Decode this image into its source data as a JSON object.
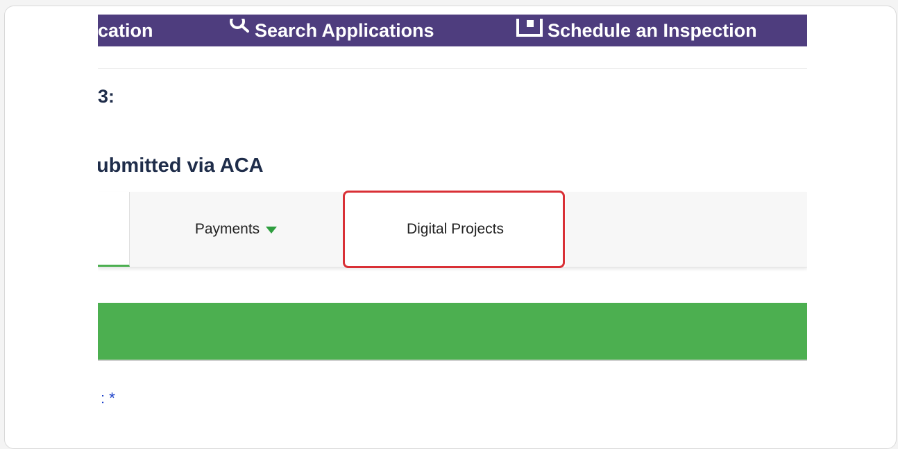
{
  "nav": {
    "items": [
      {
        "label": "cation",
        "icon": ""
      },
      {
        "label": "Search Applications",
        "icon": "search-icon"
      },
      {
        "label": "Schedule an Inspection",
        "icon": "calendar-icon"
      }
    ],
    "background": "#4e3d7e"
  },
  "page": {
    "heading_partial": "3:",
    "subheading_partial": "ubmitted via ACA"
  },
  "tabs": {
    "payments_label": "Payments",
    "digital_projects_label": "Digital Projects",
    "active_accent": "#4caf50",
    "highlight_color": "#d93036"
  },
  "form": {
    "required_marker": ": *"
  }
}
